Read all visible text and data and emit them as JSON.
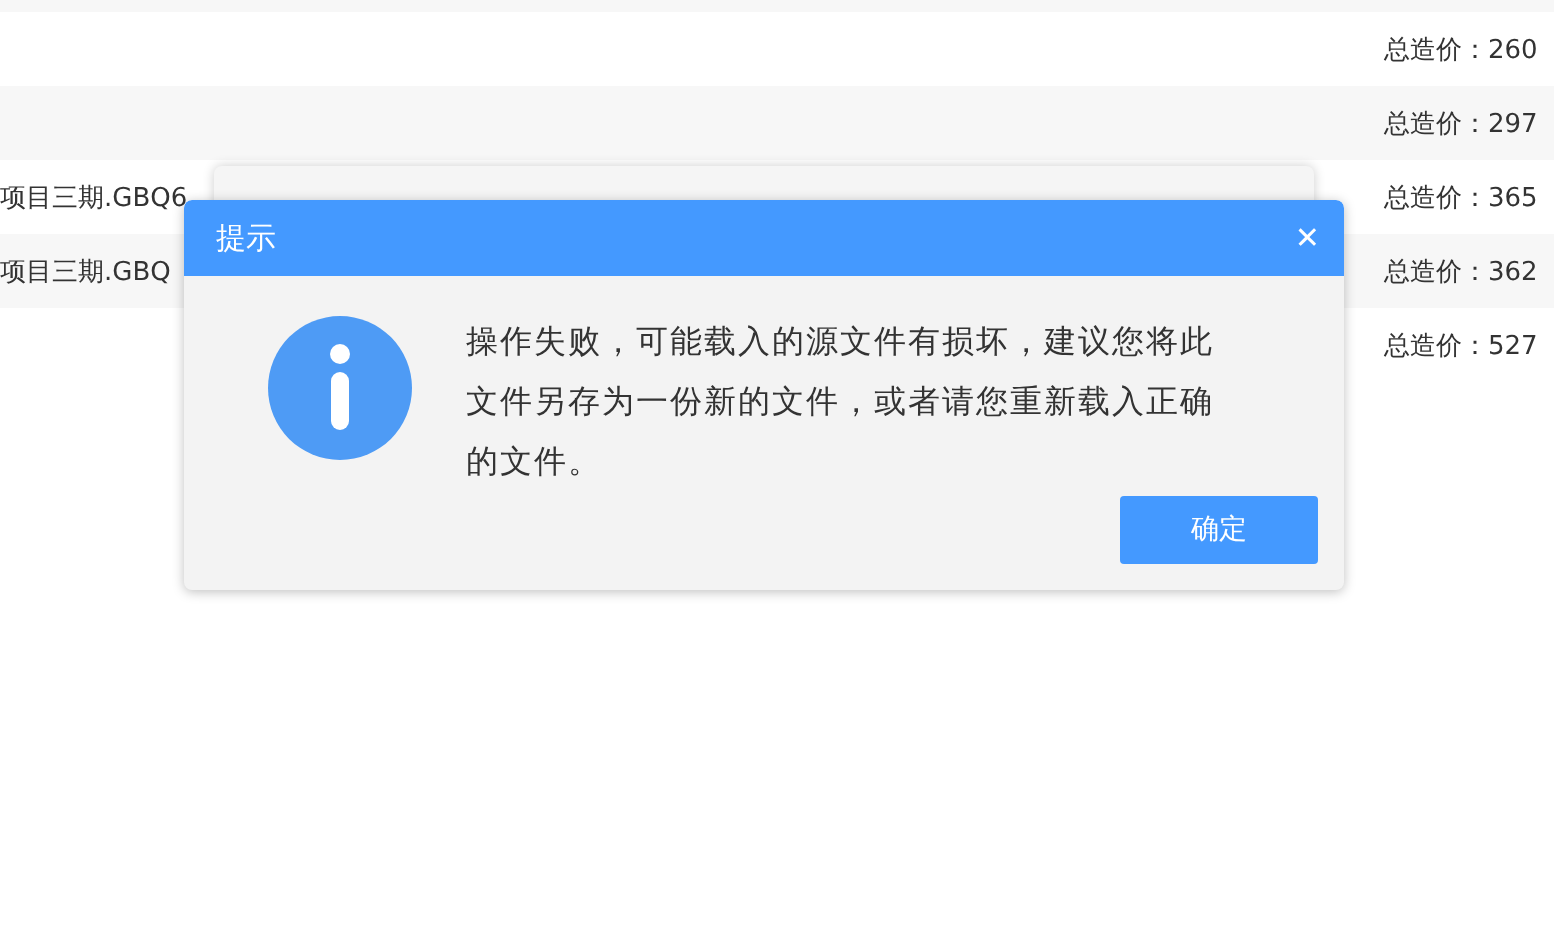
{
  "rows": [
    {
      "file": "",
      "total": "总造价：260"
    },
    {
      "file": "",
      "total": "总造价：297"
    },
    {
      "file": "项目三期.GBQ6",
      "total": "总造价：365"
    },
    {
      "file": "项目三期.GBQ",
      "total": "总造价：362"
    },
    {
      "file": "",
      "total": "总造价：527"
    }
  ],
  "dialog": {
    "title": "提示",
    "close": "✕",
    "message": "操作失败，可能载入的源文件有损坏，建议您将此文件另存为一份新的文件，或者请您重新载入正确的文件。",
    "button": "确定"
  }
}
